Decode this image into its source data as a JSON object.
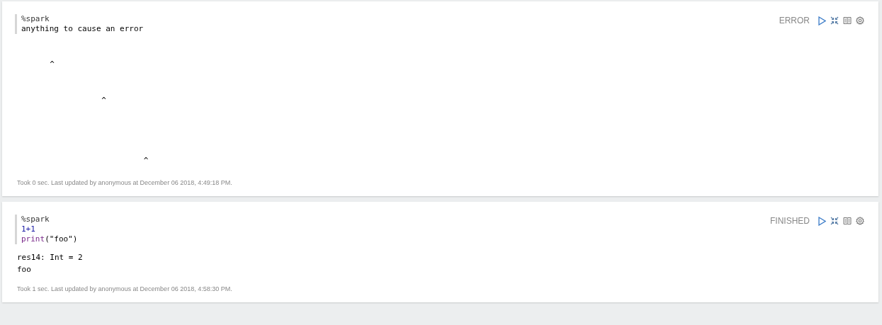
{
  "paragraphs": [
    {
      "status": "ERROR",
      "code": [
        [
          {
            "kind": "directive",
            "text": "%spark"
          }
        ],
        [
          {
            "kind": "plain",
            "text": "anything to cause an error"
          }
        ]
      ],
      "output": "\n\n       ^\n\n\n                  ^\n\n\n\n\n                           ^",
      "footer": "Took 0 sec. Last updated by anonymous at December 06 2018, 4:49:18 PM."
    },
    {
      "status": "FINISHED",
      "code": [
        [
          {
            "kind": "directive",
            "text": "%spark"
          }
        ],
        [
          {
            "kind": "number",
            "text": "1+1"
          }
        ],
        [
          {
            "kind": "keyword",
            "text": "print"
          },
          {
            "kind": "plain",
            "text": "(\"foo\")"
          }
        ]
      ],
      "output": "res14: Int = 2\nfoo",
      "footer": "Took 1 sec. Last updated by anonymous at December 06 2018, 4:58:30 PM."
    }
  ]
}
